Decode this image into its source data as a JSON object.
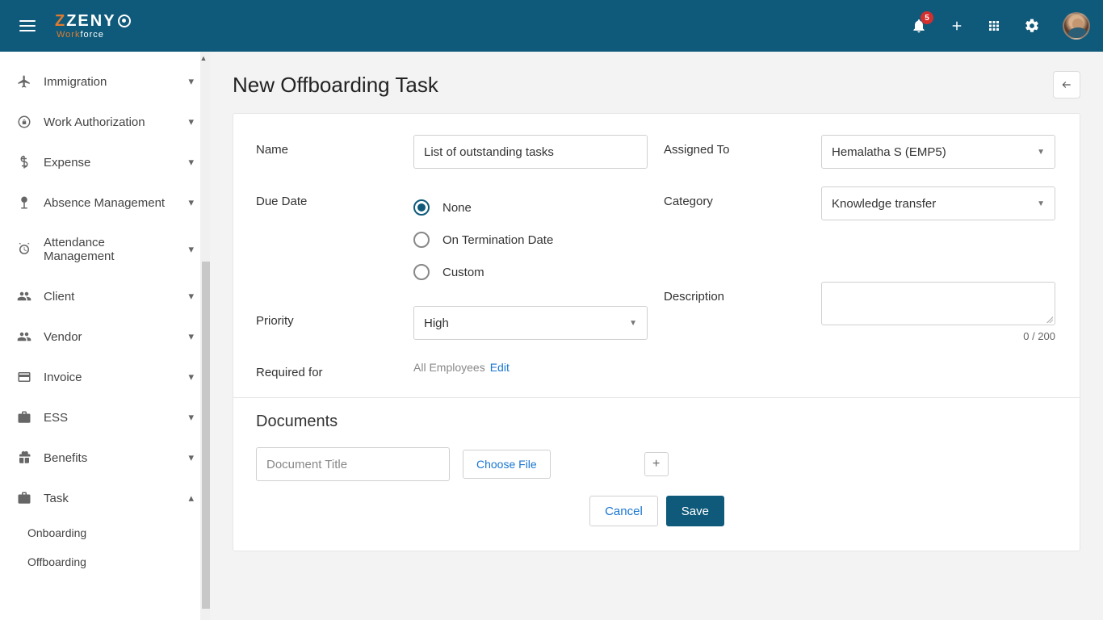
{
  "header": {
    "logo_main": "ZENY",
    "logo_sub_orange": "Work",
    "logo_sub_white": "force",
    "notification_count": "5"
  },
  "sidebar": {
    "items": [
      {
        "label": "Immigration",
        "icon": "plane"
      },
      {
        "label": "Work Authorization",
        "icon": "globe-lock"
      },
      {
        "label": "Expense",
        "icon": "dollar"
      },
      {
        "label": "Absence Management",
        "icon": "tree"
      },
      {
        "label": "Attendance Management",
        "icon": "clock"
      },
      {
        "label": "Client",
        "icon": "people"
      },
      {
        "label": "Vendor",
        "icon": "people"
      },
      {
        "label": "Invoice",
        "icon": "card"
      },
      {
        "label": "ESS",
        "icon": "briefcase"
      },
      {
        "label": "Benefits",
        "icon": "gift"
      },
      {
        "label": "Task",
        "icon": "briefcase"
      }
    ],
    "task_subitems": [
      "Onboarding",
      "Offboarding"
    ]
  },
  "page": {
    "title": "New Offboarding Task",
    "labels": {
      "name": "Name",
      "due_date": "Due Date",
      "priority": "Priority",
      "required_for": "Required for",
      "assigned_to": "Assigned To",
      "category": "Category",
      "description": "Description"
    },
    "form": {
      "name": "List of outstanding tasks",
      "due_date_options": [
        "None",
        "On Termination Date",
        "Custom"
      ],
      "due_date_selected": "None",
      "priority": "High",
      "required_for_value": "All Employees",
      "required_for_edit": "Edit",
      "assigned_to": "Hemalatha S (EMP5)",
      "category": "Knowledge transfer",
      "description": "",
      "desc_counter": "0 / 200"
    },
    "documents": {
      "title": "Documents",
      "placeholder": "Document Title",
      "choose_file": "Choose File"
    },
    "actions": {
      "cancel": "Cancel",
      "save": "Save"
    }
  }
}
